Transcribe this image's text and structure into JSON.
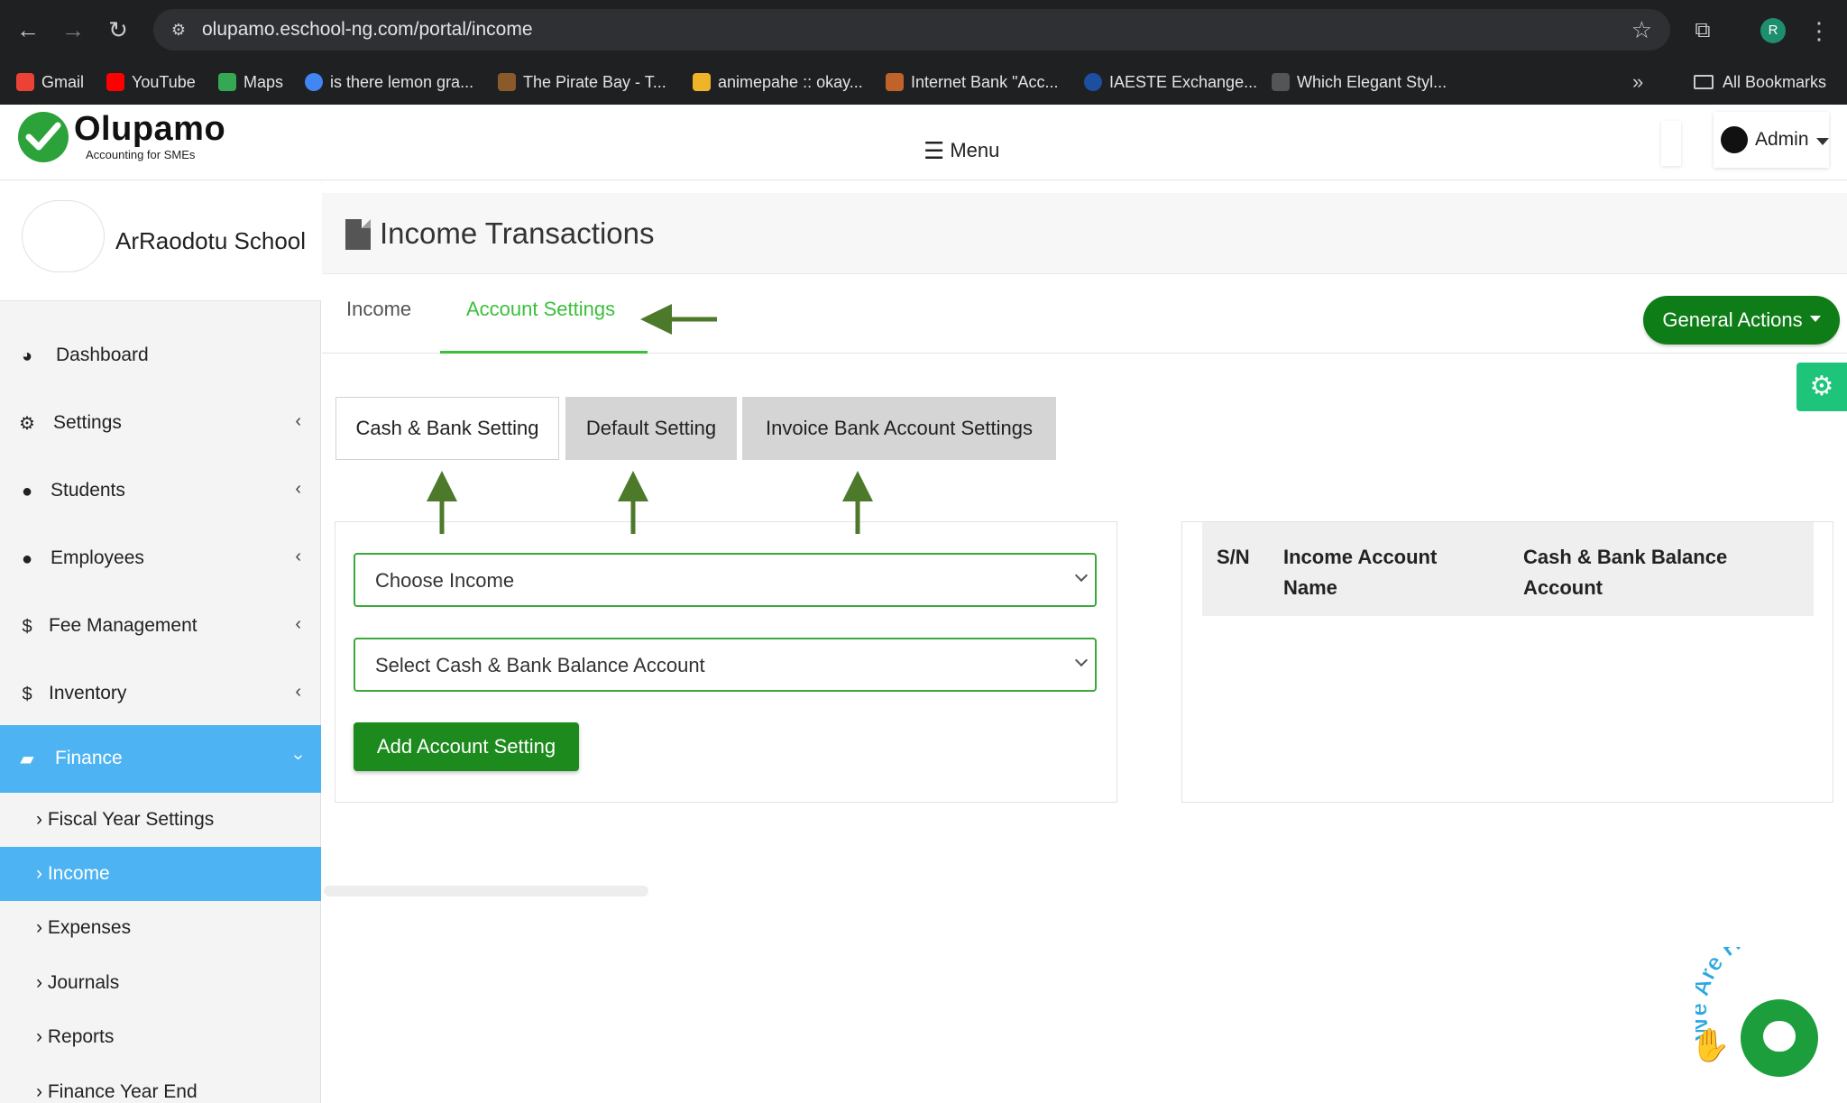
{
  "browser": {
    "url": "olupamo.eschool-ng.com/portal/income",
    "profile_initial": "R",
    "bookmarks": [
      {
        "label": "Gmail",
        "color": "#ea4335"
      },
      {
        "label": "YouTube",
        "color": "#ff0000"
      },
      {
        "label": "Maps",
        "color": "#34a853"
      },
      {
        "label": "is there lemon gra...",
        "color": "#4285f4"
      },
      {
        "label": "The Pirate Bay - T...",
        "color": "#8a5a2b"
      },
      {
        "label": "animepahe :: okay...",
        "color": "#f0b429"
      },
      {
        "label": "Internet Bank \"Acc...",
        "color": "#c0632a"
      },
      {
        "label": "IAESTE Exchange...",
        "color": "#1c4fa0"
      },
      {
        "label": "Which Elegant Styl...",
        "color": "#555555"
      }
    ],
    "all_bookmarks": "All Bookmarks"
  },
  "header": {
    "brand": "Olupamo",
    "tagline": "Accounting for SMEs",
    "menu_label": "Menu",
    "user_label": "Admin"
  },
  "sidebar": {
    "school_name": "ArRaodotu School",
    "items": [
      {
        "label": "Dashboard",
        "icon": "dashboard-icon"
      },
      {
        "label": "Settings",
        "icon": "gear-icon"
      },
      {
        "label": "Students",
        "icon": "user-icon"
      },
      {
        "label": "Employees",
        "icon": "user-icon"
      },
      {
        "label": "Fee Management",
        "icon": "dollar-icon"
      },
      {
        "label": "Inventory",
        "icon": "dollar-icon"
      },
      {
        "label": "Finance",
        "icon": "book-icon"
      }
    ],
    "finance_sub": [
      {
        "label": "Fiscal Year Settings"
      },
      {
        "label": "Income"
      },
      {
        "label": "Expenses"
      },
      {
        "label": "Journals"
      },
      {
        "label": "Reports"
      },
      {
        "label": "Finance Year End"
      }
    ]
  },
  "main": {
    "title": "Income Transactions",
    "tabs": [
      {
        "label": "Income"
      },
      {
        "label": "Account Settings"
      }
    ],
    "general_actions": "General Actions",
    "subtabs": [
      {
        "label": "Cash & Bank Setting"
      },
      {
        "label": "Default Setting"
      },
      {
        "label": "Invoice Bank Account Settings"
      }
    ],
    "form": {
      "income_select": "Choose Income",
      "account_select": "Select Cash & Bank Balance Account",
      "submit": "Add Account Setting"
    },
    "table": {
      "headers": [
        "S/N",
        "Income Account Name",
        "Cash & Bank Balance Account"
      ]
    }
  },
  "chat": {
    "text": "We Are Here!"
  },
  "colors": {
    "accent_green": "#3bbf3b",
    "active_blue": "#4eb3f2",
    "button_green": "#1d8a1d",
    "arrow_green": "#4d7a2a"
  }
}
